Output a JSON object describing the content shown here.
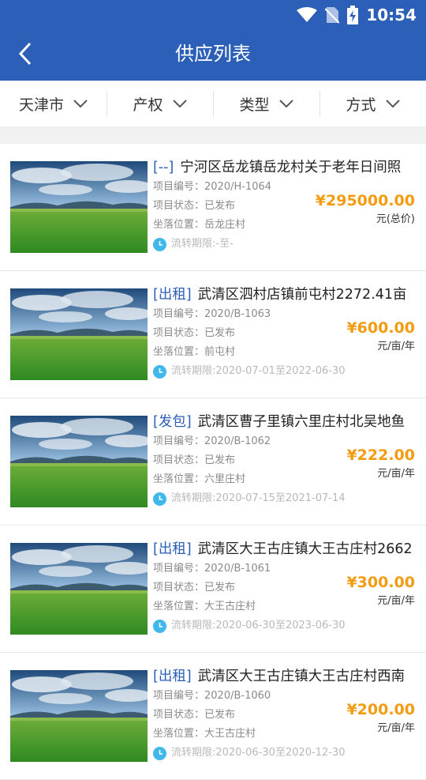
{
  "status_bar": {
    "time": "10:54"
  },
  "header": {
    "title": "供应列表"
  },
  "filters": [
    {
      "label": "天津市"
    },
    {
      "label": "产权"
    },
    {
      "label": "类型"
    },
    {
      "label": "方式"
    }
  ],
  "list_labels": {
    "code": "项目编号：",
    "status": "项目状态：",
    "location": "坐落位置：",
    "period": "流转期限:"
  },
  "items": [
    {
      "tag": "[--]",
      "title": "宁河区岳龙镇岳龙村关于老年日间照",
      "code": "2020/H-1064",
      "status": "已发布",
      "location": "岳龙庄村",
      "period": "-至-",
      "price": "¥295000.00",
      "unit": "元(总价)"
    },
    {
      "tag": "[出租]",
      "title": "武清区泗村店镇前屯村2272.41亩",
      "code": "2020/B-1063",
      "status": "已发布",
      "location": "前屯村",
      "period": "2020-07-01至2022-06-30",
      "price": "¥600.00",
      "unit": "元/亩/年"
    },
    {
      "tag": "[发包]",
      "title": "武清区曹子里镇六里庄村北吴地鱼",
      "code": "2020/B-1062",
      "status": "已发布",
      "location": "六里庄村",
      "period": "2020-07-15至2021-07-14",
      "price": "¥222.00",
      "unit": "元/亩/年"
    },
    {
      "tag": "[出租]",
      "title": "武清区大王古庄镇大王古庄村2662",
      "code": "2020/B-1061",
      "status": "已发布",
      "location": "大王古庄村",
      "period": "2020-06-30至2023-06-30",
      "price": "¥300.00",
      "unit": "元/亩/年"
    },
    {
      "tag": "[出租]",
      "title": "武清区大王古庄镇大王古庄村西南",
      "code": "2020/B-1060",
      "status": "已发布",
      "location": "大王古庄村",
      "period": "2020-06-30至2020-12-30",
      "price": "¥200.00",
      "unit": "元/亩/年"
    }
  ],
  "colors": {
    "primary": "#2b5fb8",
    "price": "#f39c12",
    "clock": "#41b8ec"
  }
}
